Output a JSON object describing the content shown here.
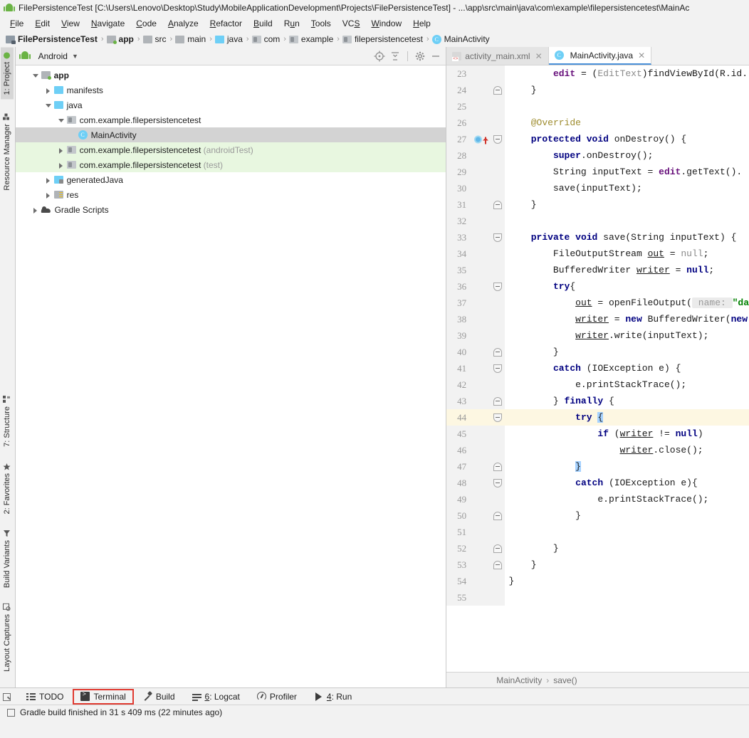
{
  "window": {
    "title": "FilePersistenceTest [C:\\Users\\Lenovo\\Desktop\\Study\\MobileApplicationDevelopment\\Projects\\FilePersistenceTest] - ...\\app\\src\\main\\java\\com\\example\\filepersistencetest\\MainAc",
    "app_icon": "android-robot-icon"
  },
  "menubar": {
    "items": [
      {
        "label": "File",
        "mnemonic": "F"
      },
      {
        "label": "Edit",
        "mnemonic": "E"
      },
      {
        "label": "View",
        "mnemonic": "V"
      },
      {
        "label": "Navigate",
        "mnemonic": "N"
      },
      {
        "label": "Code",
        "mnemonic": "C"
      },
      {
        "label": "Analyze",
        "mnemonic": "A"
      },
      {
        "label": "Refactor",
        "mnemonic": "R"
      },
      {
        "label": "Build",
        "mnemonic": "B"
      },
      {
        "label": "Run",
        "mnemonic": "u"
      },
      {
        "label": "Tools",
        "mnemonic": "T"
      },
      {
        "label": "VCS",
        "mnemonic": "S"
      },
      {
        "label": "Window",
        "mnemonic": "W"
      },
      {
        "label": "Help",
        "mnemonic": "H"
      }
    ]
  },
  "breadcrumb": {
    "items": [
      {
        "label": "FilePersistenceTest",
        "icon": "project-folder-icon",
        "bold": true
      },
      {
        "label": "app",
        "icon": "module-folder-icon",
        "bold": true
      },
      {
        "label": "src",
        "icon": "folder-icon",
        "bold": false
      },
      {
        "label": "main",
        "icon": "folder-icon",
        "bold": false
      },
      {
        "label": "java",
        "icon": "source-folder-icon",
        "bold": false
      },
      {
        "label": "com",
        "icon": "package-icon",
        "bold": false
      },
      {
        "label": "example",
        "icon": "package-icon",
        "bold": false
      },
      {
        "label": "filepersistencetest",
        "icon": "package-icon",
        "bold": false
      },
      {
        "label": "MainActivity",
        "icon": "java-class-icon",
        "bold": false
      }
    ],
    "separator": "›"
  },
  "left_tool_strip": {
    "top_items": [
      {
        "label": "1: Project",
        "icon": "android-project-icon",
        "selected": true
      },
      {
        "label": "Resource Manager",
        "icon": "resource-manager-icon",
        "selected": false
      }
    ],
    "bottom_items": [
      {
        "label": "7: Structure",
        "icon": "structure-icon",
        "selected": false
      },
      {
        "label": "2: Favorites",
        "icon": "star-icon",
        "selected": false
      },
      {
        "label": "Build Variants",
        "icon": "build-variants-icon",
        "selected": false
      },
      {
        "label": "Layout Captures",
        "icon": "layout-captures-icon",
        "selected": false
      }
    ]
  },
  "project_panel": {
    "view_selector": "Android",
    "view_selector_icon": "android-robot-icon",
    "dropdown_icon": "chevron-down-icon",
    "toolbar_icons": [
      "locate-target-icon",
      "collapse-all-icon",
      "settings-gear-icon",
      "hide-minimize-icon"
    ],
    "tree": [
      {
        "label": "app",
        "suffix": "",
        "depth": 0,
        "arrow": "down",
        "icon": "module-folder-icon",
        "bold": true,
        "state": "normal"
      },
      {
        "label": "manifests",
        "suffix": "",
        "depth": 1,
        "arrow": "right",
        "icon": "blue-folder-icon",
        "bold": false,
        "state": "normal"
      },
      {
        "label": "java",
        "suffix": "",
        "depth": 1,
        "arrow": "down",
        "icon": "blue-folder-icon",
        "bold": false,
        "state": "normal"
      },
      {
        "label": "com.example.filepersistencetest",
        "suffix": "",
        "depth": 2,
        "arrow": "down",
        "icon": "package-icon",
        "bold": false,
        "state": "normal"
      },
      {
        "label": "MainActivity",
        "suffix": "",
        "depth": 3,
        "arrow": "none",
        "icon": "java-class-icon",
        "bold": false,
        "state": "selected"
      },
      {
        "label": "com.example.filepersistencetest",
        "suffix": "(androidTest)",
        "depth": 2,
        "arrow": "right",
        "icon": "package-icon",
        "bold": false,
        "state": "green"
      },
      {
        "label": "com.example.filepersistencetest",
        "suffix": "(test)",
        "depth": 2,
        "arrow": "right",
        "icon": "package-icon",
        "bold": false,
        "state": "green"
      },
      {
        "label": "generatedJava",
        "suffix": "",
        "depth": 1,
        "arrow": "right",
        "icon": "generated-folder-icon",
        "bold": false,
        "state": "normal"
      },
      {
        "label": "res",
        "suffix": "",
        "depth": 1,
        "arrow": "right",
        "icon": "res-folder-icon",
        "bold": false,
        "state": "normal"
      },
      {
        "label": "Gradle Scripts",
        "suffix": "",
        "depth": 0,
        "arrow": "right",
        "icon": "gradle-elephant-icon",
        "bold": false,
        "state": "normal"
      }
    ]
  },
  "editor": {
    "tabs": [
      {
        "label": "activity_main.xml",
        "icon": "xml-layout-icon",
        "active": false,
        "close_icon": "close-icon"
      },
      {
        "label": "MainActivity.java",
        "icon": "java-class-icon",
        "active": true,
        "close_icon": "close-icon"
      }
    ],
    "first_line": 23,
    "highlighted_line": 44,
    "lines": [
      {
        "n": 23,
        "html": "        <span class=\"fld\">edit</span> = (<span class=\"cast\">EditText</span>)findViewById(R.id."
      },
      {
        "n": 24,
        "html": "    }",
        "fold": "up"
      },
      {
        "n": 25,
        "html": ""
      },
      {
        "n": 26,
        "html": "    <span class=\"ann\">@Override</span>"
      },
      {
        "n": 27,
        "html": "    <span class=\"kw\">protected void</span> onDestroy() {",
        "fold": "down",
        "gutter_icons": [
          "run-method-icon",
          "override-arrow-icon"
        ]
      },
      {
        "n": 28,
        "html": "        <span class=\"kw\">super</span>.onDestroy();"
      },
      {
        "n": 29,
        "html": "        String inputText = <span class=\"fld\">edit</span>.getText()."
      },
      {
        "n": 30,
        "html": "        save(inputText);"
      },
      {
        "n": 31,
        "html": "    }",
        "fold": "up"
      },
      {
        "n": 32,
        "html": ""
      },
      {
        "n": 33,
        "html": "    <span class=\"kw\">private void</span> save(String inputText) {",
        "fold": "down"
      },
      {
        "n": 34,
        "html": "        FileOutputStream <span class=\"lvar\">out</span> = <span class=\"cast\">null</span>;"
      },
      {
        "n": 35,
        "html": "        BufferedWriter <span class=\"lvar\">writer</span> = <span class=\"kw\">null</span>;"
      },
      {
        "n": 36,
        "html": "        <span class=\"kw\">try</span>{",
        "fold": "down"
      },
      {
        "n": 37,
        "html": "            <span class=\"lvar\">out</span> = openFileOutput(<span class=\"hint\"> name: </span><span class=\"str\">\"da</span>"
      },
      {
        "n": 38,
        "html": "            <span class=\"lvar\">writer</span> = <span class=\"kw\">new</span> BufferedWriter(<span class=\"kw\">new</span>"
      },
      {
        "n": 39,
        "html": "            <span class=\"lvar\">writer</span>.write(inputText);"
      },
      {
        "n": 40,
        "html": "        }",
        "fold": "up"
      },
      {
        "n": 41,
        "html": "        <span class=\"kw\">catch</span> (IOException e) {",
        "fold": "down"
      },
      {
        "n": 42,
        "html": "            e.printStackTrace();"
      },
      {
        "n": 43,
        "html": "        } <span class=\"kw\">finally</span> {",
        "fold": "up"
      },
      {
        "n": 44,
        "html": "            <span class=\"kw\">try</span> <span class=\"selbr\">{</span>",
        "fold": "down",
        "highlight": true
      },
      {
        "n": 45,
        "html": "                <span class=\"kw\">if</span> (<span class=\"lvar\">writer</span> != <span class=\"kw\">null</span>)"
      },
      {
        "n": 46,
        "html": "                    <span class=\"lvar\">writer</span>.close();"
      },
      {
        "n": 47,
        "html": "            <span class=\"selbr\">}</span>",
        "fold": "up"
      },
      {
        "n": 48,
        "html": "            <span class=\"kw\">catch</span> (IOException e){",
        "fold": "down"
      },
      {
        "n": 49,
        "html": "                e.printStackTrace();"
      },
      {
        "n": 50,
        "html": "            }",
        "fold": "up"
      },
      {
        "n": 51,
        "html": ""
      },
      {
        "n": 52,
        "html": "        }",
        "fold": "up"
      },
      {
        "n": 53,
        "html": "    }",
        "fold": "up"
      },
      {
        "n": 54,
        "html": "}"
      },
      {
        "n": 55,
        "html": ""
      }
    ],
    "status_breadcrumb": [
      "MainActivity",
      "save()"
    ],
    "status_breadcrumb_sep": "›"
  },
  "bottom_toolbar": {
    "buttons": [
      {
        "label": "TODO",
        "icon": "todo-list-icon",
        "prefix": "",
        "highlighted": false
      },
      {
        "label": "Terminal",
        "icon": "terminal-icon",
        "prefix": "",
        "highlighted": true
      },
      {
        "label": "Build",
        "icon": "build-hammer-icon",
        "prefix": "",
        "highlighted": false
      },
      {
        "label": "6: Logcat",
        "icon": "logcat-icon",
        "prefix": "6",
        "highlighted": false
      },
      {
        "label": "Profiler",
        "icon": "profiler-icon",
        "prefix": "",
        "highlighted": false
      },
      {
        "label": "4: Run",
        "icon": "run-play-icon",
        "prefix": "4",
        "highlighted": false
      }
    ],
    "highlight_color": "#e03a30"
  },
  "statusbar": {
    "icon": "event-log-icon",
    "message": "Gradle build finished in 31 s 409 ms (22 minutes ago)"
  },
  "colors": {
    "accent_blue": "#4a90d9",
    "selection_blue": "#a6d2ff",
    "tree_selection": "#d3d3d3",
    "test_source_green": "#e8f7e0",
    "highlight_line": "#fdf7e2",
    "red_box": "#e03a30",
    "keyword": "#000080",
    "string": "#008000",
    "annotation": "#9e8c2e",
    "field": "#660e7a"
  }
}
